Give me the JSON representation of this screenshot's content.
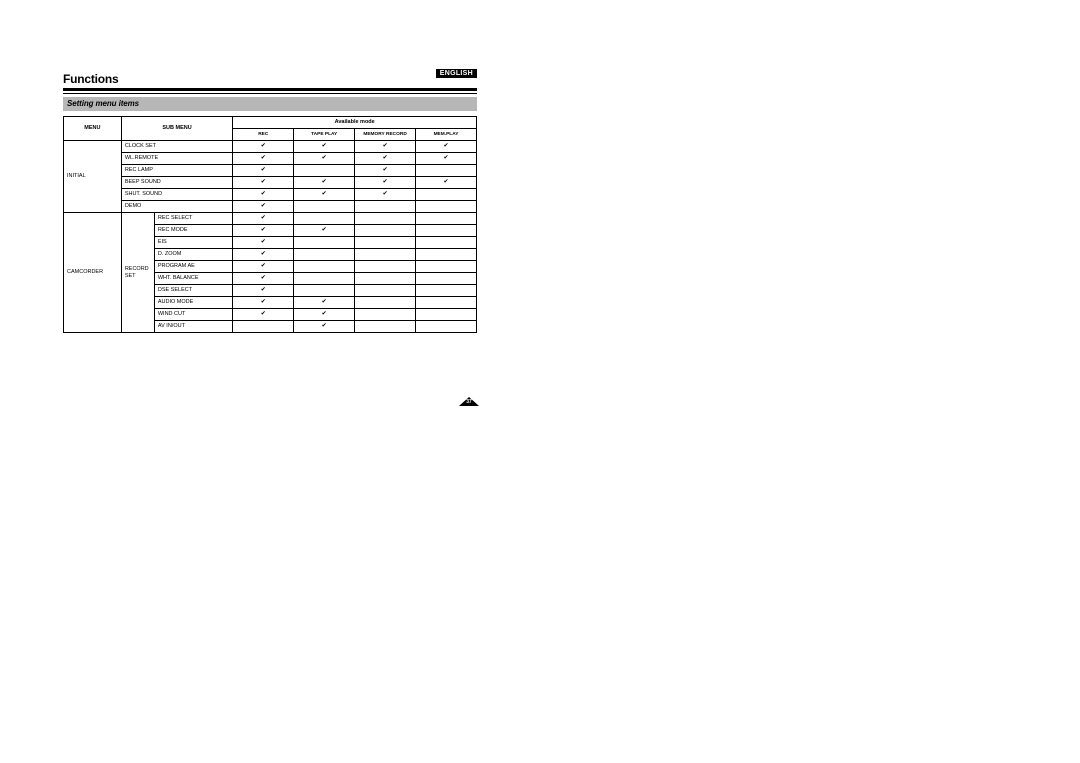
{
  "language_badge": "ENGLISH",
  "heading": "Functions",
  "subtitle": "Setting menu items",
  "headers": {
    "menu": "MENU",
    "sub_menu": "SUB MENU",
    "available_mode": "Available mode",
    "modes": [
      "REC",
      "TAPE PLAY",
      "MEMORY RECORD",
      "MEM.PLAY"
    ]
  },
  "groups": [
    {
      "menu": "INITIAL",
      "sub1": "",
      "rows": [
        {
          "name": "CLOCK SET",
          "modes": [
            true,
            true,
            true,
            true
          ]
        },
        {
          "name": "WL.REMOTE",
          "modes": [
            true,
            true,
            true,
            true
          ]
        },
        {
          "name": "REC LAMP",
          "modes": [
            true,
            false,
            true,
            false
          ]
        },
        {
          "name": "BEEP SOUND",
          "modes": [
            true,
            true,
            true,
            true
          ]
        },
        {
          "name": "SHUT. SOUND",
          "modes": [
            true,
            true,
            true,
            false
          ]
        },
        {
          "name": "DEMO",
          "modes": [
            true,
            false,
            false,
            false
          ]
        }
      ]
    },
    {
      "menu": "CAMCORDER",
      "sub1": "RECORD SET",
      "rows": [
        {
          "name": "REC SELECT",
          "modes": [
            true,
            false,
            false,
            false
          ]
        },
        {
          "name": "REC MODE",
          "modes": [
            true,
            true,
            false,
            false
          ]
        },
        {
          "name": "EIS",
          "modes": [
            true,
            false,
            false,
            false
          ]
        },
        {
          "name": "D. ZOOM",
          "modes": [
            true,
            false,
            false,
            false
          ]
        },
        {
          "name": "PROGRAM AE",
          "modes": [
            true,
            false,
            false,
            false
          ]
        },
        {
          "name": "WHT. BALANCE",
          "modes": [
            true,
            false,
            false,
            false
          ]
        },
        {
          "name": "DSE SELECT",
          "modes": [
            true,
            false,
            false,
            false
          ]
        },
        {
          "name": "AUDIO MODE",
          "modes": [
            true,
            true,
            false,
            false
          ]
        },
        {
          "name": "WIND CUT",
          "modes": [
            true,
            true,
            false,
            false
          ]
        },
        {
          "name": "AV IN/OUT",
          "modes": [
            false,
            true,
            false,
            false
          ]
        }
      ]
    }
  ],
  "page_number": "37",
  "checkmark": "✔"
}
